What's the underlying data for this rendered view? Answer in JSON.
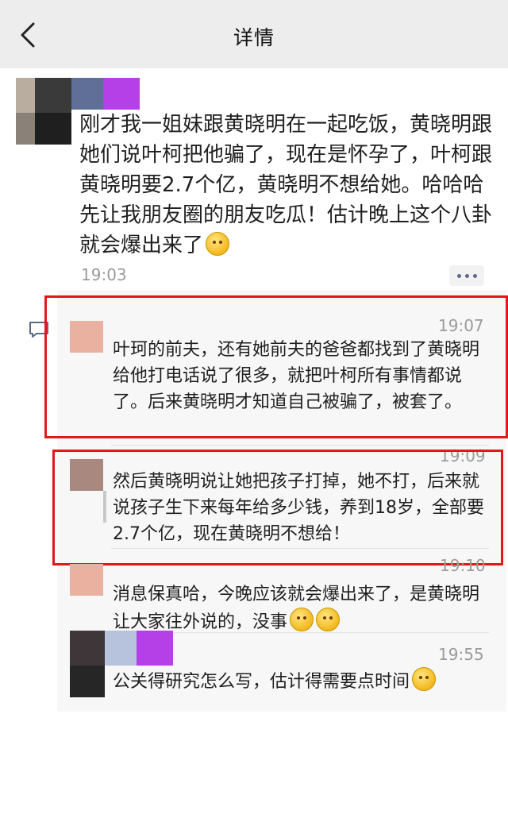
{
  "nav": {
    "title": "详情",
    "back_icon": "back-chevron-icon"
  },
  "post": {
    "text": "刚才我一姐妹跟黄晓明在一起吃饭，黄晓明跟她们说叶柯把他骗了，现在是怀孕了，叶柯跟黄晓明要2.7个亿，黄晓明不想给她。哈哈哈先让我朋友圈的朋友吃瓜！估计晚上这个八卦就会爆出来了",
    "emoji": "smirk-emoji",
    "time": "19:03",
    "more_icon": "more-dots-icon"
  },
  "comments": [
    {
      "time": "19:07",
      "text": "叶珂的前夫，还有她前夫的爸爸都找到了黄晓明给他打电话说了很多，就把叶柯所有事情都说了。后来黄晓明才知道自己被骗了，被套了。"
    },
    {
      "time": "19:09",
      "text": "然后黄晓明说让她把孩子打掉，她不打，后来就说孩子生下来每年给多少钱，养到18岁，全部要2.7个亿，现在黄晓明不想给！"
    },
    {
      "time": "19:10",
      "text": "消息保真哈，今晚应该就会爆出来了，是黄晓明让大家往外说的，没事",
      "emoji": "thinking-emoji"
    },
    {
      "time": "19:55",
      "text": "公关得研究怎么写，估计得需要点时间",
      "emoji": "thinking-emoji"
    }
  ],
  "colors": {
    "navbar_bg": "#ededed",
    "comment_bg": "#f7f7f7",
    "highlight_box": "#e01818",
    "timestamp": "#9b9b9b"
  }
}
